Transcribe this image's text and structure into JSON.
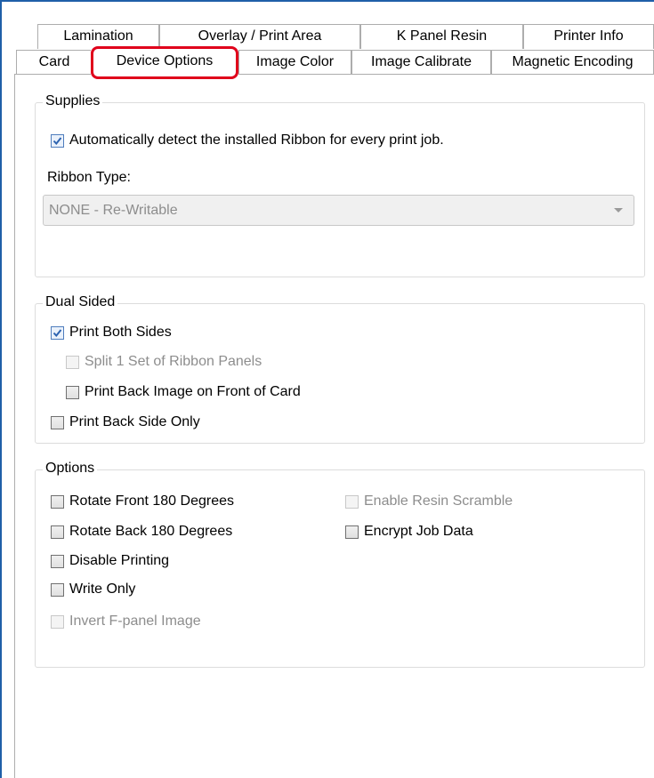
{
  "tabs_back": [
    "Lamination",
    "Overlay / Print Area",
    "K Panel Resin",
    "Printer Info"
  ],
  "tabs_front": [
    "Card",
    "Device Options",
    "Image Color",
    "Image Calibrate",
    "Magnetic Encoding"
  ],
  "active_tab": "Device Options",
  "supplies": {
    "title": "Supplies",
    "auto_detect": {
      "label": "Automatically detect the installed Ribbon for every print job.",
      "checked": true
    },
    "ribbon_type_label": "Ribbon Type:",
    "ribbon_type_value": "NONE - Re-Writable"
  },
  "dual_sided": {
    "title": "Dual Sided",
    "print_both_sides": {
      "label": "Print Both Sides",
      "checked": true
    },
    "split_ribbon": {
      "label": "Split 1 Set of Ribbon Panels",
      "checked": false,
      "enabled": false
    },
    "print_back_on_front": {
      "label": "Print Back Image on Front of Card",
      "checked": false
    },
    "print_back_only": {
      "label": "Print Back Side Only",
      "checked": false
    }
  },
  "options": {
    "title": "Options",
    "rotate_front": {
      "label": "Rotate Front 180 Degrees",
      "checked": false
    },
    "rotate_back": {
      "label": "Rotate Back 180 Degrees",
      "checked": false
    },
    "disable_printing": {
      "label": "Disable Printing",
      "checked": false
    },
    "write_only": {
      "label": "Write Only",
      "checked": false
    },
    "invert_f_panel": {
      "label": "Invert F-panel Image",
      "checked": false,
      "enabled": false
    },
    "enable_resin_scramble": {
      "label": "Enable Resin Scramble",
      "checked": false,
      "enabled": false
    },
    "encrypt_job_data": {
      "label": "Encrypt Job Data",
      "checked": false
    }
  },
  "colors": {
    "highlight": "#e0001b",
    "window_border": "#1f5fa8",
    "check": "#2d63b0"
  }
}
